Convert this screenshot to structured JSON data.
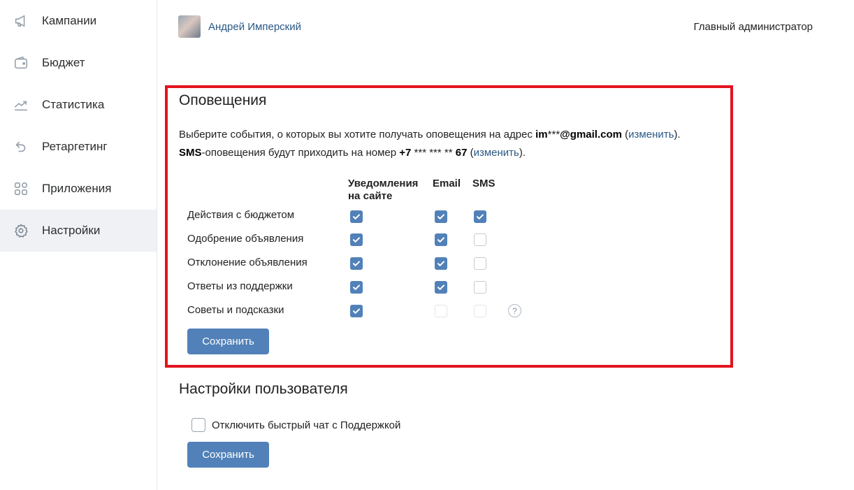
{
  "sidebar": {
    "items": [
      {
        "label": "Кампании",
        "icon": "megaphone-icon"
      },
      {
        "label": "Бюджет",
        "icon": "wallet-icon"
      },
      {
        "label": "Статистика",
        "icon": "chart-icon"
      },
      {
        "label": "Ретаргетинг",
        "icon": "undo-arrow-icon"
      },
      {
        "label": "Приложения",
        "icon": "apps-grid-icon"
      },
      {
        "label": "Настройки",
        "icon": "gear-icon",
        "active": true
      }
    ]
  },
  "header": {
    "user_name": "Андрей Имперский",
    "role": "Главный администратор"
  },
  "notifications": {
    "title": "Оповещения",
    "line1_prefix": "Выберите события, о которых вы хотите получать оповещения на адрес ",
    "email_bold_start": "im",
    "email_masked": "***",
    "email_bold_end": "@gmail.com",
    "open_paren": " (",
    "change_link": "изменить",
    "close_paren_dot": ").",
    "sms_bold": "SMS",
    "line2_middle": "-оповещения будут приходить на номер ",
    "phone_bold_start": "+7",
    "phone_masked": " *** *** ** ",
    "phone_bold_end": "67",
    "columns": {
      "site_line1": "Уведомления",
      "site_line2": "на сайте",
      "email": "Email",
      "sms": "SMS"
    },
    "rows": [
      {
        "label": "Действия с бюджетом",
        "site": "on",
        "email": "on",
        "sms": "on"
      },
      {
        "label": "Одобрение объявления",
        "site": "on",
        "email": "on",
        "sms": "off"
      },
      {
        "label": "Отклонение объявления",
        "site": "on",
        "email": "on",
        "sms": "off"
      },
      {
        "label": "Ответы из поддержки",
        "site": "on",
        "email": "on",
        "sms": "off"
      },
      {
        "label": "Советы и подсказки",
        "site": "on",
        "email": "disabled",
        "sms": "disabled",
        "help": "?"
      }
    ],
    "save_label": "Сохранить"
  },
  "user_settings": {
    "title": "Настройки пользователя",
    "chat_label": "Отключить быстрый чат с Поддержкой",
    "chat_checked": false,
    "save_label": "Сохранить"
  },
  "colors": {
    "accent": "#5181b8",
    "link": "#2a5885",
    "highlight_border": "#e2141f"
  }
}
